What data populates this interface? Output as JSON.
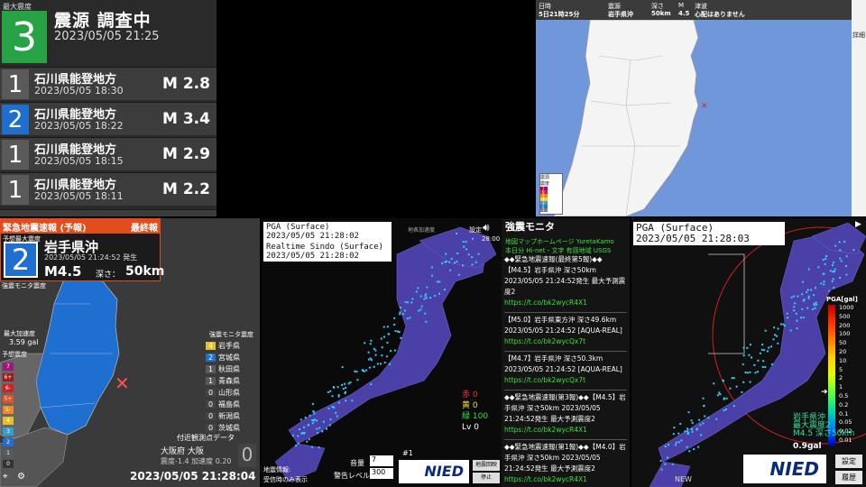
{
  "top_left": {
    "header_label": "最大震度",
    "max_intensity": "3",
    "source_title": "震源 調査中",
    "source_time": "2023/05/05  21:25",
    "rows": [
      {
        "intensity": "1",
        "color": "#5a5a5a",
        "place": "石川県能登地方",
        "time": "2023/05/05  18:30",
        "mag": "M 2.8"
      },
      {
        "intensity": "2",
        "color": "#1f6fd0",
        "place": "石川県能登地方",
        "time": "2023/05/05  18:22",
        "mag": "M 3.4"
      },
      {
        "intensity": "1",
        "color": "#5a5a5a",
        "place": "石川県能登地方",
        "time": "2023/05/05  18:15",
        "mag": "M 2.9"
      },
      {
        "intensity": "1",
        "color": "#5a5a5a",
        "place": "石川県能登地方",
        "time": "2023/05/05  18:11",
        "mag": "M 2.2"
      }
    ]
  },
  "top_right": {
    "headers": [
      "日時",
      "震源",
      "深さ",
      "M",
      "津波"
    ],
    "values": [
      "5日21時25分",
      "岩手県沖",
      "50km",
      "4.5",
      "心配はありません"
    ],
    "side_label": "詳細",
    "legend_title": "震源",
    "legend_sub": "震度",
    "legend_items": [
      "7",
      "6",
      "5",
      "4",
      "3",
      "2",
      "1"
    ]
  },
  "eew": {
    "bar_title": "緊急地震速報 (予報)",
    "bar_final": "最終報",
    "max_label": "予想最大震度",
    "intensity": "2",
    "region": "岩手県沖",
    "time": "2023/05/05 21:24:52 発生",
    "mag": "M4.5",
    "depth_label": "深さ：",
    "depth": "50km",
    "side_label1": "強震モニタ震度",
    "side_label2": "最大加速度",
    "accel": "3.59 gal",
    "forecast_label": "予想震度",
    "scale": [
      "7",
      "6+",
      "6-",
      "5+",
      "5-",
      "4",
      "3",
      "2",
      "1",
      "0"
    ],
    "monitor": [
      {
        "i": "4",
        "name": "岩手県",
        "color": "#e6c02c"
      },
      {
        "i": "2",
        "name": "宮城県",
        "color": "#1f6fd0"
      },
      {
        "i": "1",
        "name": "秋田県",
        "color": "#5a5a5a"
      },
      {
        "i": "1",
        "name": "青森県",
        "color": "#5a5a5a"
      },
      {
        "i": "0",
        "name": "山形県",
        "color": "#444"
      },
      {
        "i": "0",
        "name": "福島県",
        "color": "#444"
      },
      {
        "i": "0",
        "name": "新潟県",
        "color": "#444"
      },
      {
        "i": "0",
        "name": "茨城県",
        "color": "#444"
      }
    ],
    "nearby_title": "付近観測点データ",
    "nearby_place": "大阪府 大阪",
    "nearby_vals": "震度-1.4  加速度 0.20",
    "nearby_int": "0",
    "clock": "2023/05/05 21:28:04"
  },
  "kmoni": {
    "pga_title": "PGA (Surface)",
    "pga_time": "2023/05/05 21:28:02",
    "sindo_title": "Realtime Sindo (Surface)",
    "sindo_time": "2023/05/05 21:28:02",
    "settings": "設定",
    "time": "28:00",
    "small_label": "地表加速度",
    "counts": [
      {
        "label": "赤 0",
        "color": "#ff3030"
      },
      {
        "label": "黄 0",
        "color": "#f0e030"
      },
      {
        "label": "緑 100",
        "color": "#30e030"
      },
      {
        "label": "Lv 0",
        "color": "#ffffff"
      }
    ],
    "volume_label": "音量",
    "volume_value": "7",
    "alert_label": "警告レベル",
    "alert_value": "300",
    "info_label": "地震情報:",
    "info_sub": "受信時のみ表示",
    "index": "#1",
    "btn_map": "地震回映",
    "btn_stop": "停止",
    "logo": "NIED"
  },
  "feed": {
    "title": "強震モニタ",
    "links": "地図マップホームページ  YuretaKamo",
    "links2": "本日分  Hi-net・文字  有感地域  USGS",
    "items": [
      {
        "head": "◆◆緊急地震速報(最終第5報)◆◆",
        "body": "【M4.5】岩手県沖 深さ50km 2023/05/05 21:24:52発生 最大予測震度2",
        "url": "https://t.co/bk2wycR4X1"
      },
      {
        "head": "【M5.0】岩手県東方沖 深さ49.6km",
        "body": "2023/05/05 21:24:52 [AQUA-REAL]",
        "url": "https://t.co/bk2wycQx7t"
      },
      {
        "head": "【M4.7】岩手県沖 深さ50.3km",
        "body": "2023/05/05 21:24:52 [AQUA-REAL]",
        "url": "https://t.co/bk2wycQx7t"
      },
      {
        "head": "◆◆緊急地震速報(第3報)◆◆【M4.5】岩",
        "body": "手県沖 深さ50km 2023/05/05 21:24:52発生 最大予測震度2",
        "url": "https://t.co/bk2wycR4X1"
      },
      {
        "head": "◆◆緊急地震速報(第1報)◆◆【M4.0】岩",
        "body": "手県沖 深さ50km 2023/05/05 21:24:52発生 最大予測震度2",
        "url": "https://t.co/bk2wycR4X1"
      }
    ]
  },
  "far": {
    "pga_title": "PGA (Surface)",
    "pga_time": "2023/05/05 21:28:03",
    "legend_title": "PGA[gal]",
    "legend": [
      "1000",
      "500",
      "200",
      "100",
      "50",
      "20",
      "10",
      "5",
      "2",
      "1",
      "0.5",
      "0.2",
      "0.1",
      "0.05",
      "0.02",
      "0.01"
    ],
    "overlay1": "岩手県沖",
    "overlay2": "最大震度2",
    "overlay3": "M4.5 深さ50km",
    "gal": "0.9gal",
    "new": "NEW",
    "btn_settings": "設定",
    "btn_history": "履歴",
    "logo": "NIED",
    "arrow": "▶"
  }
}
